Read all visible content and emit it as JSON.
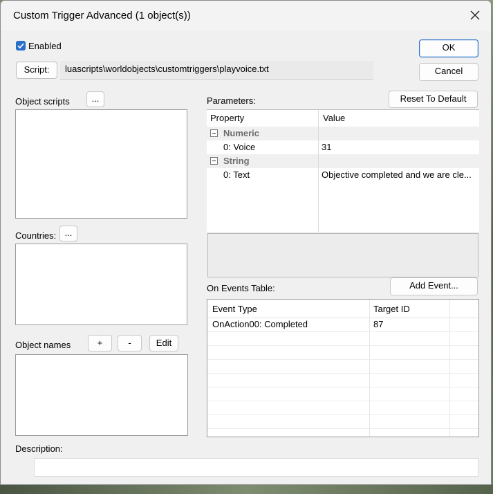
{
  "window": {
    "title": "Custom Trigger Advanced (1 object(s))"
  },
  "enabled": {
    "label": "Enabled",
    "checked": true
  },
  "script": {
    "button_label": "Script:",
    "path": "luascripts\\worldobjects\\customtriggers\\playvoice.txt"
  },
  "dialog_buttons": {
    "ok": "OK",
    "cancel": "Cancel"
  },
  "left": {
    "object_scripts_label": "Object scripts",
    "object_scripts_button": "...",
    "countries_label": "Countries:",
    "countries_button": "...",
    "object_names_label": "Object names",
    "add_label": "+",
    "remove_label": "-",
    "edit_label": "Edit"
  },
  "parameters": {
    "label": "Parameters:",
    "reset_button": "Reset To Default",
    "columns": [
      "Property",
      "Value"
    ],
    "categories": [
      {
        "name": "Numeric",
        "rows": [
          {
            "property": "0: Voice",
            "value": "31"
          }
        ]
      },
      {
        "name": "String",
        "rows": [
          {
            "property": "0: Text",
            "value": "Objective completed and we are cle..."
          }
        ]
      }
    ]
  },
  "events": {
    "label": "On Events Table:",
    "add_button": "Add Event...",
    "columns": [
      "Event Type",
      "Target ID"
    ],
    "rows": [
      {
        "event_type": "OnAction00: Completed",
        "target_id": "87"
      }
    ]
  },
  "description": {
    "label": "Description:",
    "value": ""
  },
  "colors": {
    "accent": "#2a73c5",
    "checkbox": "#2a6fc9",
    "category_text": "#6d6d6d"
  },
  "icons": {
    "close": "close-icon",
    "checkmark": "checkmark-icon",
    "collapse": "collapse-icon"
  }
}
